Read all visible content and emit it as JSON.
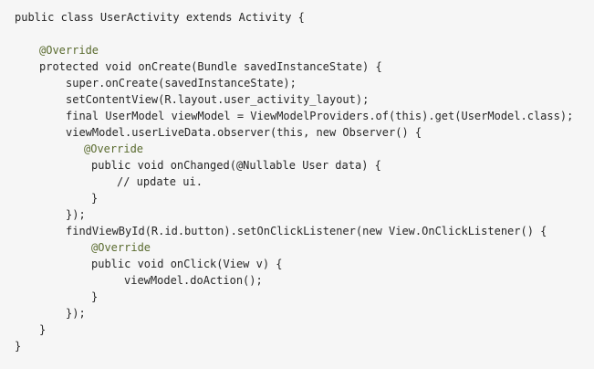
{
  "code": {
    "lines": [
      "public class UserActivity extends Activity {",
      "",
      "@Override",
      "protected void onCreate(Bundle savedInstanceState) {",
      "super.onCreate(savedInstanceState);",
      "setContentView(R.layout.user_activity_layout);",
      "final UserModel viewModel = ViewModelProviders.of(this).get(UserModel.class);",
      "viewModel.userLiveData.observer(this, new Observer() {",
      "@Override",
      "public void onChanged(@Nullable User data) {",
      "// update ui.",
      "}",
      "});",
      "findViewById(R.id.button).setOnClickListener(new View.OnClickListener() {",
      "@Override",
      "public void onClick(View v) {",
      "viewModel.doAction();",
      "}",
      "});",
      "}",
      "}"
    ]
  }
}
